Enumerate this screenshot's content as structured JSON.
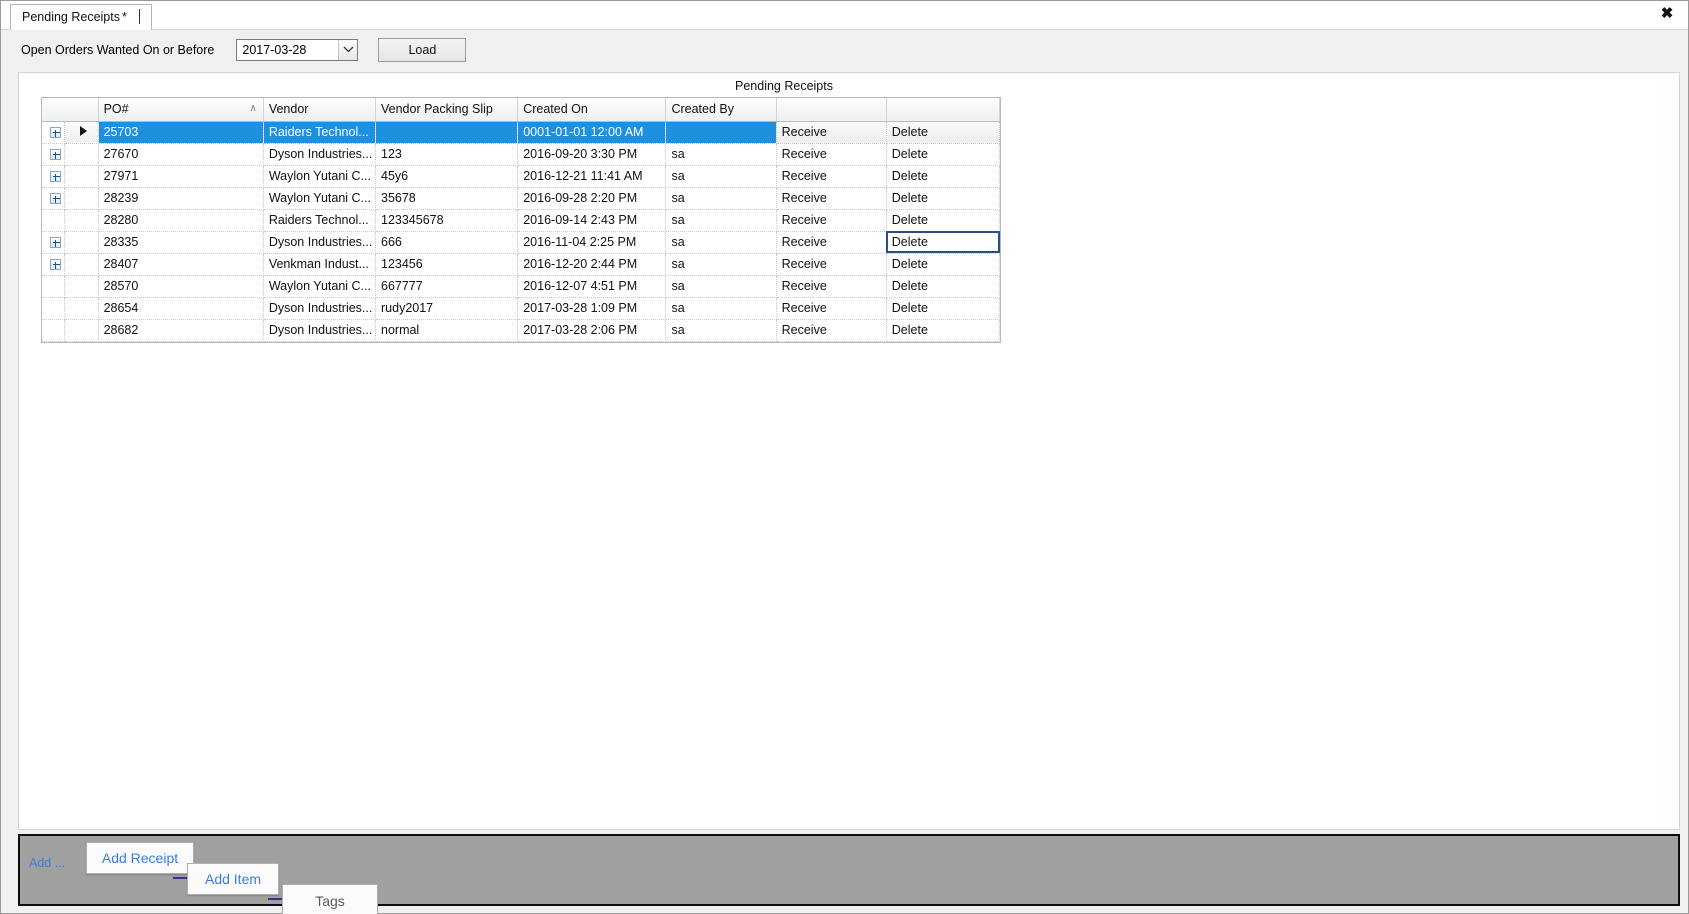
{
  "window": {
    "close_label": "✖"
  },
  "tab": {
    "label": "Pending Receipts",
    "dirty_marker": "*"
  },
  "filter": {
    "label": "Open Orders Wanted On or Before",
    "date_value": "2017-03-28",
    "load_label": "Load"
  },
  "grid": {
    "caption": "Pending Receipts",
    "sort_indicator": "∧",
    "columns": [
      "PO#",
      "Vendor",
      "Vendor Packing Slip",
      "Created On",
      "Created By",
      "",
      ""
    ],
    "rows": [
      {
        "po": "25703",
        "vendor": "Raiders Technol...",
        "slip": "",
        "created_on": "0001-01-01 12:00 AM",
        "created_by": "",
        "receive": "Receive",
        "delete": "Delete",
        "expandable": true,
        "selected": true,
        "current": true,
        "delete_focused": false
      },
      {
        "po": "27670",
        "vendor": "Dyson Industries...",
        "slip": "123",
        "created_on": "2016-09-20 3:30 PM",
        "created_by": "sa",
        "receive": "Receive",
        "delete": "Delete",
        "expandable": true,
        "selected": false,
        "current": false,
        "delete_focused": false
      },
      {
        "po": "27971",
        "vendor": "Waylon Yutani C...",
        "slip": "45y6",
        "created_on": "2016-12-21 11:41 AM",
        "created_by": "sa",
        "receive": "Receive",
        "delete": "Delete",
        "expandable": true,
        "selected": false,
        "current": false,
        "delete_focused": false
      },
      {
        "po": "28239",
        "vendor": "Waylon Yutani C...",
        "slip": "35678",
        "created_on": "2016-09-28 2:20 PM",
        "created_by": "sa",
        "receive": "Receive",
        "delete": "Delete",
        "expandable": true,
        "selected": false,
        "current": false,
        "delete_focused": false
      },
      {
        "po": "28280",
        "vendor": "Raiders Technol...",
        "slip": "123345678",
        "created_on": "2016-09-14 2:43 PM",
        "created_by": "sa",
        "receive": "Receive",
        "delete": "Delete",
        "expandable": false,
        "selected": false,
        "current": false,
        "delete_focused": false
      },
      {
        "po": "28335",
        "vendor": "Dyson Industries...",
        "slip": "666",
        "created_on": "2016-11-04 2:25 PM",
        "created_by": "sa",
        "receive": "Receive",
        "delete": "Delete",
        "expandable": true,
        "selected": false,
        "current": false,
        "delete_focused": true
      },
      {
        "po": "28407",
        "vendor": "Venkman  Indust...",
        "slip": "123456",
        "created_on": "2016-12-20 2:44 PM",
        "created_by": "sa",
        "receive": "Receive",
        "delete": "Delete",
        "expandable": true,
        "selected": false,
        "current": false,
        "delete_focused": false
      },
      {
        "po": "28570",
        "vendor": "Waylon Yutani C...",
        "slip": "667777",
        "created_on": "2016-12-07 4:51 PM",
        "created_by": "sa",
        "receive": "Receive",
        "delete": "Delete",
        "expandable": false,
        "selected": false,
        "current": false,
        "delete_focused": false
      },
      {
        "po": "28654",
        "vendor": "Dyson Industries...",
        "slip": "rudy2017",
        "created_on": "2017-03-28 1:09 PM",
        "created_by": "sa",
        "receive": "Receive",
        "delete": "Delete",
        "expandable": false,
        "selected": false,
        "current": false,
        "delete_focused": false
      },
      {
        "po": "28682",
        "vendor": "Dyson Industries...",
        "slip": "normal",
        "created_on": "2017-03-28 2:06 PM",
        "created_by": "sa",
        "receive": "Receive",
        "delete": "Delete",
        "expandable": false,
        "selected": false,
        "current": false,
        "delete_focused": false
      }
    ]
  },
  "toolbar": {
    "add_label": "Add ...",
    "add_receipt_label": "Add Receipt",
    "add_item_label": "Add Item",
    "tags_label": "Tags"
  },
  "colors": {
    "selection_blue": "#1e90e0",
    "link_blue": "#3b7ddd",
    "toolbar_gray": "#a0a0a0",
    "panel_gray": "#f0f0f0",
    "focus_outline": "#2a4f86"
  }
}
